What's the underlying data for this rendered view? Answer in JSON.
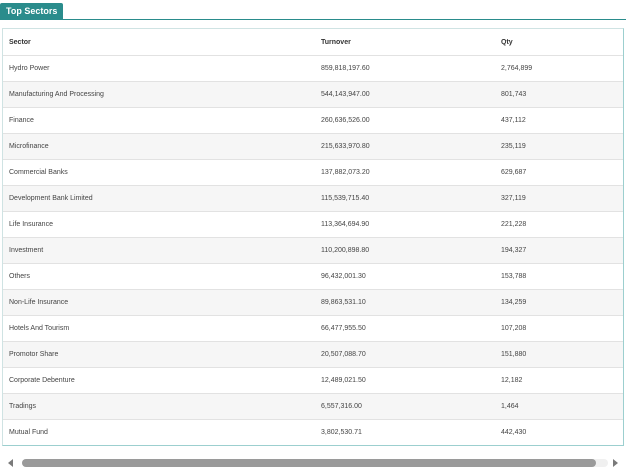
{
  "panel": {
    "tab_label": "Top Sectors"
  },
  "table": {
    "columns": [
      "Sector",
      "Turnover",
      "Qty"
    ],
    "rows": [
      {
        "sector": "Hydro Power",
        "turnover": "859,818,197.60",
        "qty": "2,764,899"
      },
      {
        "sector": "Manufacturing And Processing",
        "turnover": "544,143,947.00",
        "qty": "801,743"
      },
      {
        "sector": "Finance",
        "turnover": "260,636,526.00",
        "qty": "437,112"
      },
      {
        "sector": "Microfinance",
        "turnover": "215,633,970.80",
        "qty": "235,119"
      },
      {
        "sector": "Commercial Banks",
        "turnover": "137,882,073.20",
        "qty": "629,687"
      },
      {
        "sector": "Development Bank Limited",
        "turnover": "115,539,715.40",
        "qty": "327,119"
      },
      {
        "sector": "Life Insurance",
        "turnover": "113,364,694.90",
        "qty": "221,228"
      },
      {
        "sector": "Investment",
        "turnover": "110,200,898.80",
        "qty": "194,327"
      },
      {
        "sector": "Others",
        "turnover": "96,432,001.30",
        "qty": "153,788"
      },
      {
        "sector": "Non-Life Insurance",
        "turnover": "89,863,531.10",
        "qty": "134,259"
      },
      {
        "sector": "Hotels And Tourism",
        "turnover": "66,477,955.50",
        "qty": "107,208"
      },
      {
        "sector": "Promotor Share",
        "turnover": "20,507,088.70",
        "qty": "151,880"
      },
      {
        "sector": "Corporate Debenture",
        "turnover": "12,489,021.50",
        "qty": "12,182"
      },
      {
        "sector": "Tradings",
        "turnover": "6,557,316.00",
        "qty": "1,464"
      },
      {
        "sector": "Mutual Fund",
        "turnover": "3,802,530.71",
        "qty": "442,430"
      }
    ]
  },
  "scrollbar": {
    "thumb_fraction": 0.98
  },
  "colors": {
    "accent": "#2a8c8c",
    "row_alt": "#f6f6f6"
  },
  "icons": {
    "scroll_left": "arrow-left-icon",
    "scroll_right": "arrow-right-icon"
  }
}
